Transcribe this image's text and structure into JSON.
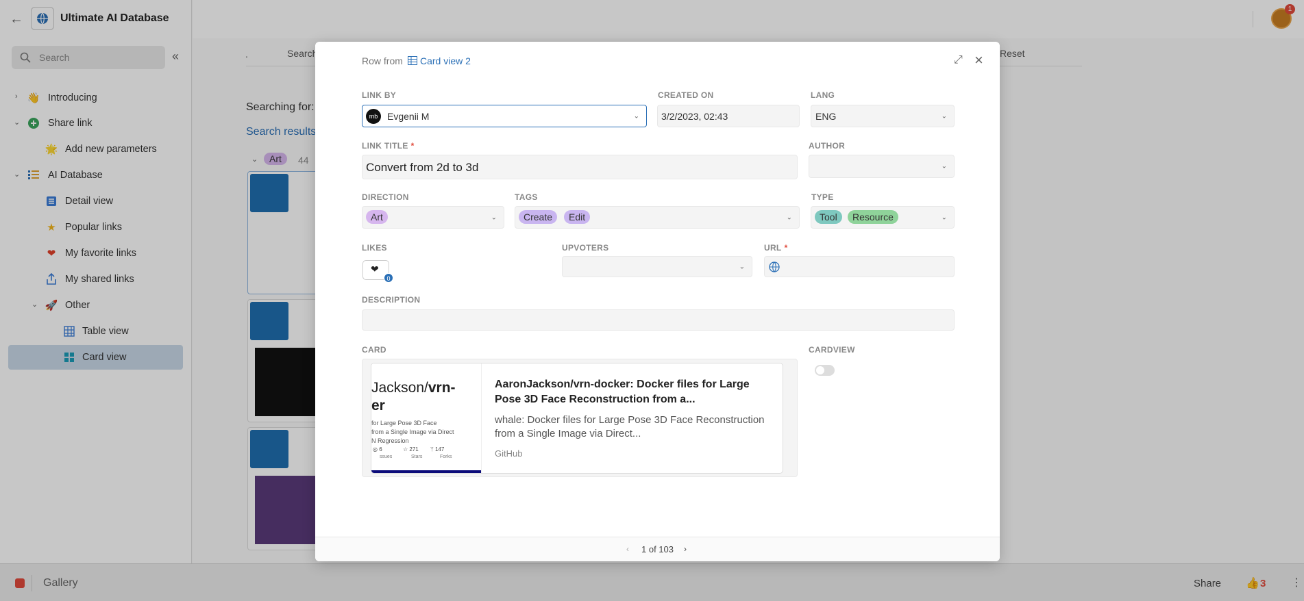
{
  "sidebar": {
    "workspace_title": "Ultimate AI Database",
    "search_placeholder": "Search",
    "items": [
      {
        "label": "Introducing"
      },
      {
        "label": "Share link"
      },
      {
        "label": "Add new parameters"
      },
      {
        "label": "AI Database"
      },
      {
        "label": "Detail view"
      },
      {
        "label": "Popular links"
      },
      {
        "label": "My favorite links"
      },
      {
        "label": "My shared links"
      },
      {
        "label": "Other"
      },
      {
        "label": "Table view"
      },
      {
        "label": "Card view"
      }
    ]
  },
  "main": {
    "dot": ".",
    "search_tab": "Search",
    "reset": "Reset",
    "searching_for": "Searching for:",
    "search_results": "Search results",
    "group_tag": "Art",
    "group_count": "44",
    "notification_count": "1"
  },
  "modal": {
    "row_from": "Row from",
    "view_name": "Card view 2",
    "link_by": {
      "label": "LINK BY",
      "value": "Evgenii M"
    },
    "created_on": {
      "label": "CREATED ON",
      "value": "3/2/2023, 02:43"
    },
    "lang": {
      "label": "LANG",
      "value": "ENG"
    },
    "link_title": {
      "label": "LINK TITLE",
      "required": "*",
      "value": "Convert from 2d to 3d"
    },
    "author": {
      "label": "AUTHOR",
      "value": ""
    },
    "direction": {
      "label": "DIRECTION",
      "value": "Art"
    },
    "tags": {
      "label": "TAGS",
      "values": [
        "Create",
        "Edit"
      ]
    },
    "type": {
      "label": "TYPE",
      "values": [
        "Tool",
        "Resource"
      ]
    },
    "likes": {
      "label": "LIKES",
      "count": "0"
    },
    "upvoters": {
      "label": "UPVOTERS"
    },
    "url": {
      "label": "URL",
      "required": "*"
    },
    "description": {
      "label": "DESCRIPTION",
      "value": ""
    },
    "card": {
      "label": "CARD",
      "thumb_title_prefix": "Jackson/",
      "thumb_title_bold": "vrn-",
      "thumb_title_line2": "er",
      "thumb_desc_1": "for Large Pose 3D Face",
      "thumb_desc_2": "from a Single Image via Direct",
      "thumb_desc_3": "N Regression",
      "thumb_stat_1_val": "6",
      "thumb_stat_1_lbl": "ssues",
      "thumb_stat_2_val": "271",
      "thumb_stat_2_lbl": "Stars",
      "thumb_stat_3_val": "147",
      "thumb_stat_3_lbl": "Forks",
      "title": "AaronJackson/vrn-docker: Docker files for Large Pose 3D Face Reconstruction from a...",
      "description": "whale: Docker files for Large Pose 3D Face Reconstruction from a Single Image via Direct...",
      "source": "GitHub"
    },
    "cardview": {
      "label": "CARDVIEW"
    },
    "pager": "1 of 103"
  },
  "bottombar": {
    "gallery": "Gallery",
    "share": "Share",
    "votes": "3"
  },
  "colors": {
    "accent": "#2a6fb6",
    "pill_art": "#d6b6ee",
    "pill_tag": "#c9b5f0",
    "pill_tool": "#7ec8bf",
    "pill_resource": "#8fd39a"
  }
}
